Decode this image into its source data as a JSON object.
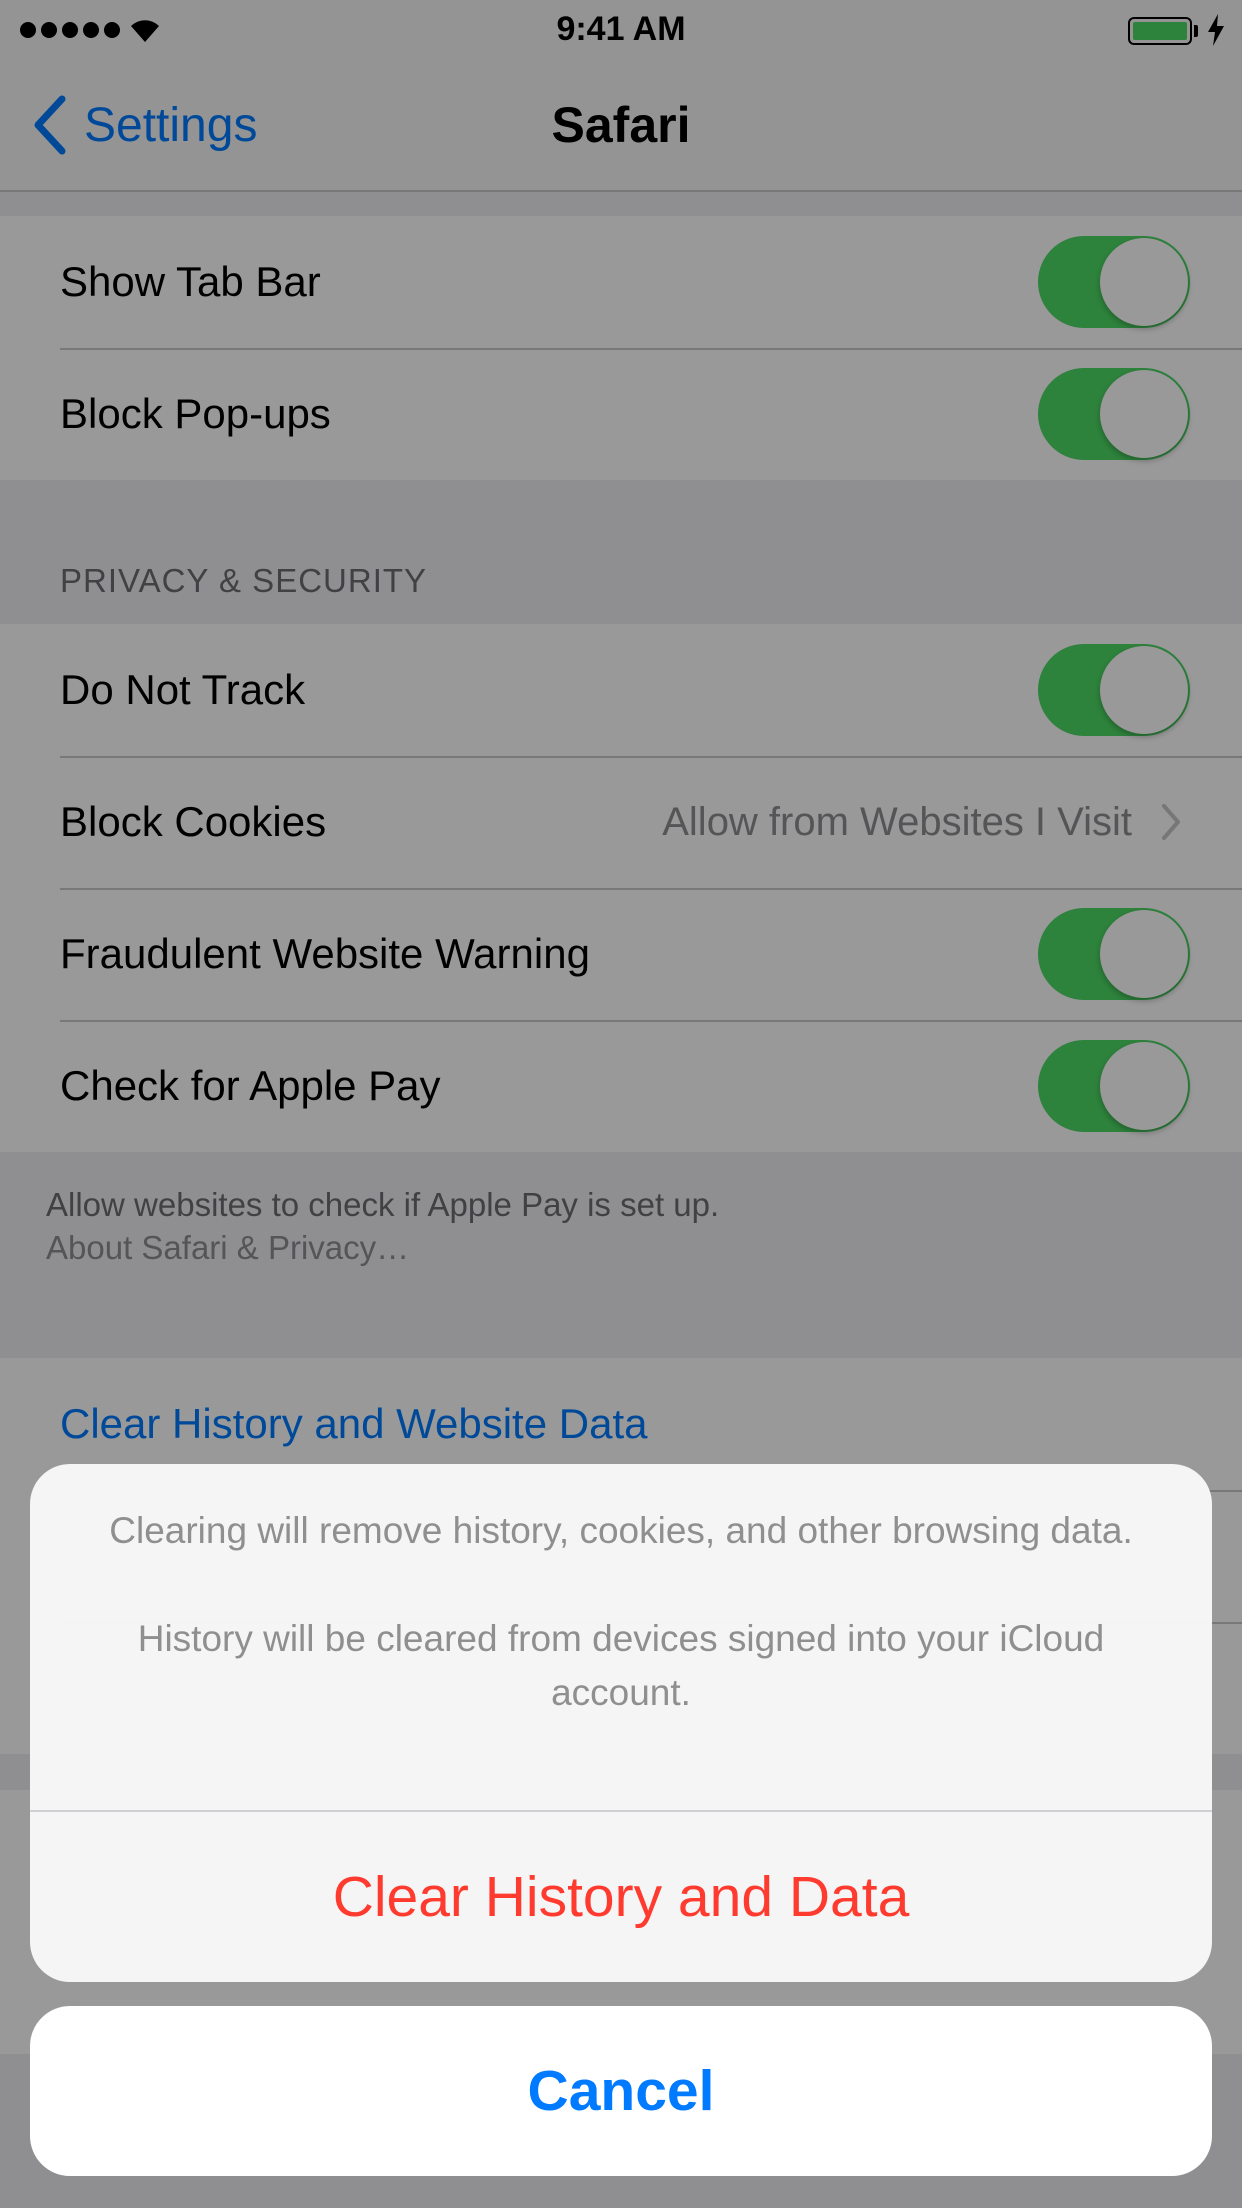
{
  "status_bar": {
    "time": "9:41 AM"
  },
  "nav": {
    "back_label": "Settings",
    "title": "Safari"
  },
  "general_rows": [
    {
      "label": "Show Tab Bar",
      "toggle_on": true
    },
    {
      "label": "Block Pop-ups",
      "toggle_on": true
    }
  ],
  "privacy": {
    "header": "PRIVACY & SECURITY",
    "rows": [
      {
        "label": "Do Not Track",
        "toggle_on": true
      },
      {
        "label": "Block Cookies",
        "value": "Allow from Websites I Visit"
      },
      {
        "label": "Fraudulent Website Warning",
        "toggle_on": true
      },
      {
        "label": "Check for Apple Pay",
        "toggle_on": true
      }
    ],
    "footer_text": "Allow websites to check if Apple Pay is set up.",
    "footer_link": "About Safari & Privacy…"
  },
  "clear_row": {
    "label": "Clear History and Website Data"
  },
  "action_sheet": {
    "message_1": "Clearing will remove history, cookies, and other browsing data.",
    "message_2": "History will be cleared from devices signed into your iCloud account.",
    "destructive_label": "Clear History and Data",
    "cancel_label": "Cancel"
  },
  "colors": {
    "toggle_on": "#4cd964",
    "tint": "#007aff",
    "destructive": "#ff3b30"
  }
}
